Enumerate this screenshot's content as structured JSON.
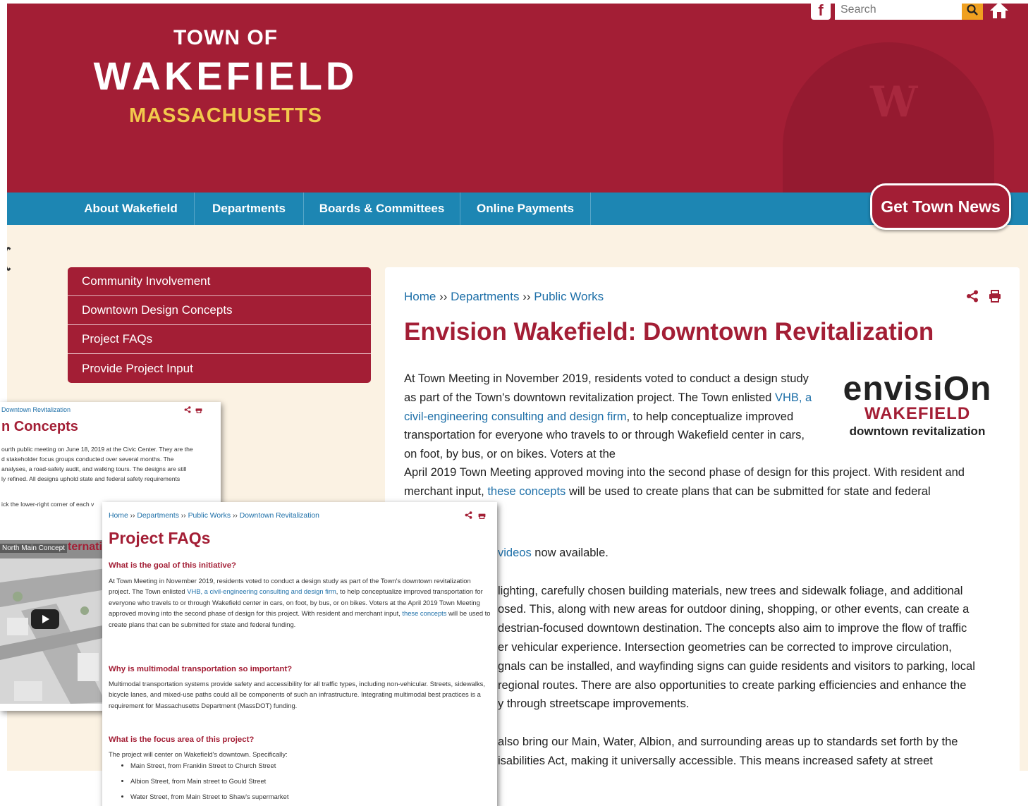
{
  "header": {
    "logo_line1": "TOWN OF",
    "logo_line2": "WAKEFIELD",
    "logo_line3": "MASSACHUSETTS",
    "search_placeholder": "Search",
    "dome_letter": "W",
    "facebook_icon": "facebook-icon",
    "search_icon": "search-icon",
    "home_icon": "home-icon"
  },
  "nav": {
    "items": [
      "About Wakefield",
      "Departments",
      "Boards & Committees",
      "Online Payments"
    ],
    "news_button": "Get Town News"
  },
  "sidebar": {
    "items": [
      "Community Involvement",
      "Downtown Design Concepts",
      "Project FAQs",
      "Provide Project Input"
    ]
  },
  "main": {
    "breadcrumb": [
      "Home",
      "Departments",
      "Public Works"
    ],
    "breadcrumb_sep": "››",
    "title": "Envision Wakefield: Downtown Revitalization",
    "intro_1": "At Town Meeting in November 2019, residents voted to conduct a design study as part of the Town's downtown revitalization project. The Town enlisted ",
    "intro_link": "VHB, a civil-engineering consulting and design firm",
    "intro_2": ", to help conceptualize improved transportation for everyone who travels to or through Wakefield center in cars, on foot, by bus, or on bikes. Voters at the",
    "intro_3": "April 2019 Town Meeting approved moving into the second phase of design for this project. With resident and merchant input, ",
    "intro_link2": "these concepts",
    "intro_4": " will be used to create plans that can be submitted for state and federal",
    "logo": {
      "word": "envisiOn",
      "sub": "WAKEFIELD",
      "tag": "downtown revitalization"
    },
    "videos_link": "videos",
    "videos_text": " now available.",
    "lines": [
      "lighting, carefully chosen building materials, new trees and sidewalk foliage, and additional",
      "osed. This, along with new areas for outdoor dining, shopping, or other events, can create a",
      "destrian-focused downtown destination. The concepts also aim to improve the flow of traffic",
      "er vehicular experience. Intersection geometries can be corrected to improve circulation,",
      "gnals can be installed, and wayfinding signs can guide residents and visitors to parking, local",
      "regional routes. There are also opportunities to create parking efficiencies and enhance the",
      "y through streetscape improvements.",
      "",
      "also bring our Main, Water, Albion, and surrounding areas up to standards set forth by the",
      "isabilities Act, making it universally accessible. This means increased safety at street"
    ]
  },
  "overlay_concepts": {
    "breadcrumb": "Downtown Revitalization",
    "title": "n Concepts",
    "lines": [
      "ourth public meeting on June 18, 2019 at the Civic Center. They are the",
      "d stakeholder focus groups conducted over several months. The",
      "analyses, a road-safety audit, and walking tours. The designs are still",
      "ly refined. All designs uphold state and federal safety requirements"
    ],
    "line_after": "ick the lower-right corner of each v",
    "video_label": "North Main Concept",
    "video_title": "ternative | Lak"
  },
  "overlay_faq": {
    "breadcrumb": [
      "Home",
      "Departments",
      "Public Works",
      "Downtown Revitalization"
    ],
    "title": "Project FAQs",
    "q1": "What is the goal of this initiative?",
    "a1_1": "At Town Meeting in November 2019, residents voted to conduct a design study as part of the Town's downtown revitalization project. The Town enlisted ",
    "a1_link": "VHB, a civil-engineering consulting and design firm",
    "a1_2": ", to help conceptualize improved transportation for everyone who travels to or through Wakefield center in cars, on foot, by bus, or on bikes. Voters at the April 2019 Town Meeting approved moving into the second phase of design for this project. With resident and merchant input, ",
    "a1_link2": "these concepts",
    "a1_3": " will be used to create plans that can be submitted for state and federal funding.",
    "q2": "Why is multimodal transportation so important?",
    "a2": "Multimodal transportation systems provide safety and accessibility for all traffic types, including non-vehicular. Streets, sidewalks, bicycle lanes, and mixed-use paths could all be components of such an infrastructure. Integrating multimodal best practices is a requirement for Massachusetts Department (MassDOT) funding.",
    "q3": "What is the focus area of this project?",
    "a3": "The project will center on Wakefield's downtown. Specifically:",
    "bullets": [
      "Main Street, from Franklin Street to Church Street",
      "Albion Street, from Main street to Gould Street",
      "Water Street, from Main Street to Shaw's supermarket"
    ]
  },
  "colors": {
    "brand_red": "#a31e35",
    "nav_blue": "#1d86b3",
    "page_bg": "#fbf2e3",
    "link_blue": "#1d6fa8",
    "gold": "#f2c94c"
  }
}
